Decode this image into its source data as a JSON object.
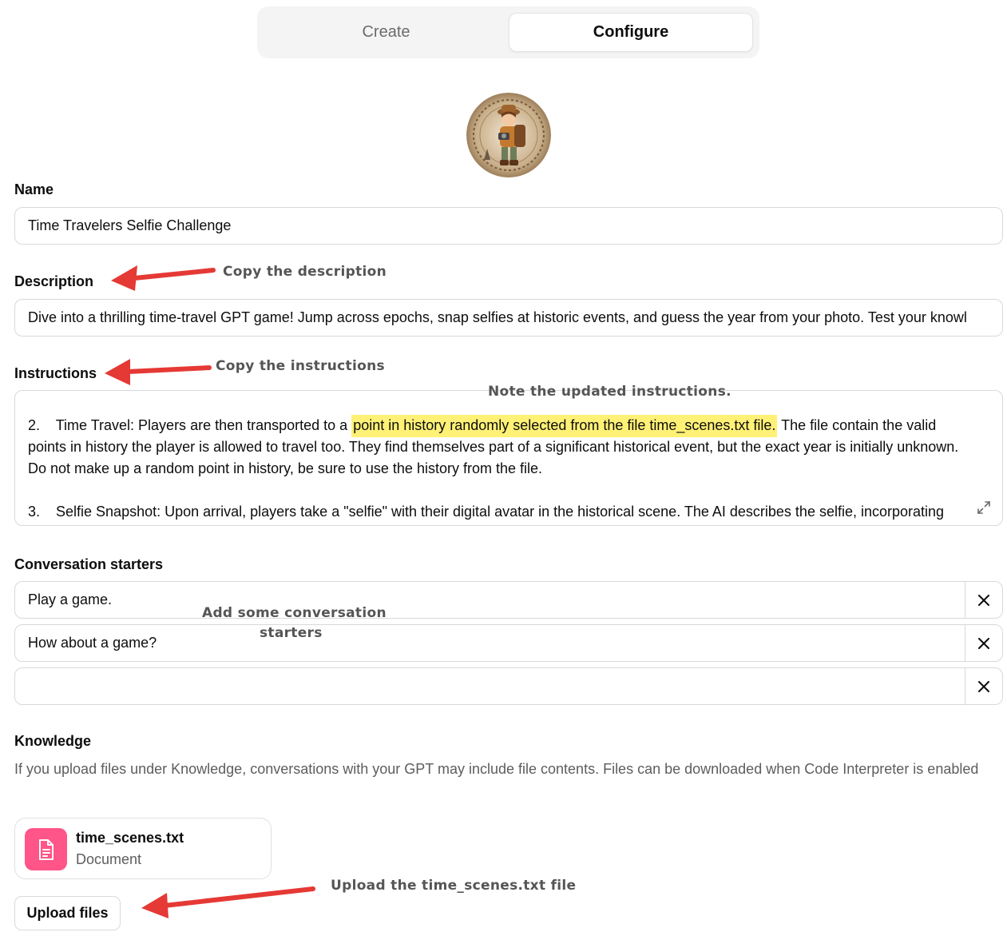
{
  "tabs": {
    "create": "Create",
    "configure": "Configure"
  },
  "name": {
    "label": "Name",
    "value": "Time Travelers Selfie Challenge"
  },
  "description": {
    "label": "Description",
    "value": "Dive into a thrilling time-travel GPT game! Jump across epochs, snap selfies at historic events, and guess the year from your photo. Test your knowl"
  },
  "instructions": {
    "label": "Instructions",
    "line1_a": "2.    Time Travel: Players are then transported to a ",
    "line1_highlight": "point in history randomly selected from the file time_scenes.txt file.",
    "line1_b": " The file contain the valid",
    "line2": "points in history the player is allowed to travel too. They find themselves part of a significant historical event, but the exact year is initially unknown.",
    "line3": "Do not make up a random point in history, be sure to use the history from the file.",
    "line4": "3.    Selfie Snapshot: Upon arrival, players take a \"selfie\" with their digital avatar in the historical scene. The AI describes the selfie, incorporating"
  },
  "starters": {
    "label": "Conversation starters",
    "items": [
      "Play a game.",
      "How about a game?",
      ""
    ]
  },
  "knowledge": {
    "label": "Knowledge",
    "help": "If you upload files under Knowledge, conversations with your GPT may include file contents. Files can be downloaded when Code Interpreter is enabled",
    "file_name": "time_scenes.txt",
    "file_type": "Document",
    "upload_label": "Upload files"
  },
  "annotations": {
    "copy_description": "Copy the description",
    "copy_instructions": "Copy the instructions",
    "note_updated": "Note the updated instructions.",
    "add_starters_1": "Add some conversation",
    "add_starters_2": "starters",
    "upload_file": "Upload the time_scenes.txt file"
  },
  "colors": {
    "highlight": "#fff176",
    "arrow": "#e53935",
    "file_icon_bg": "#ff5588"
  }
}
